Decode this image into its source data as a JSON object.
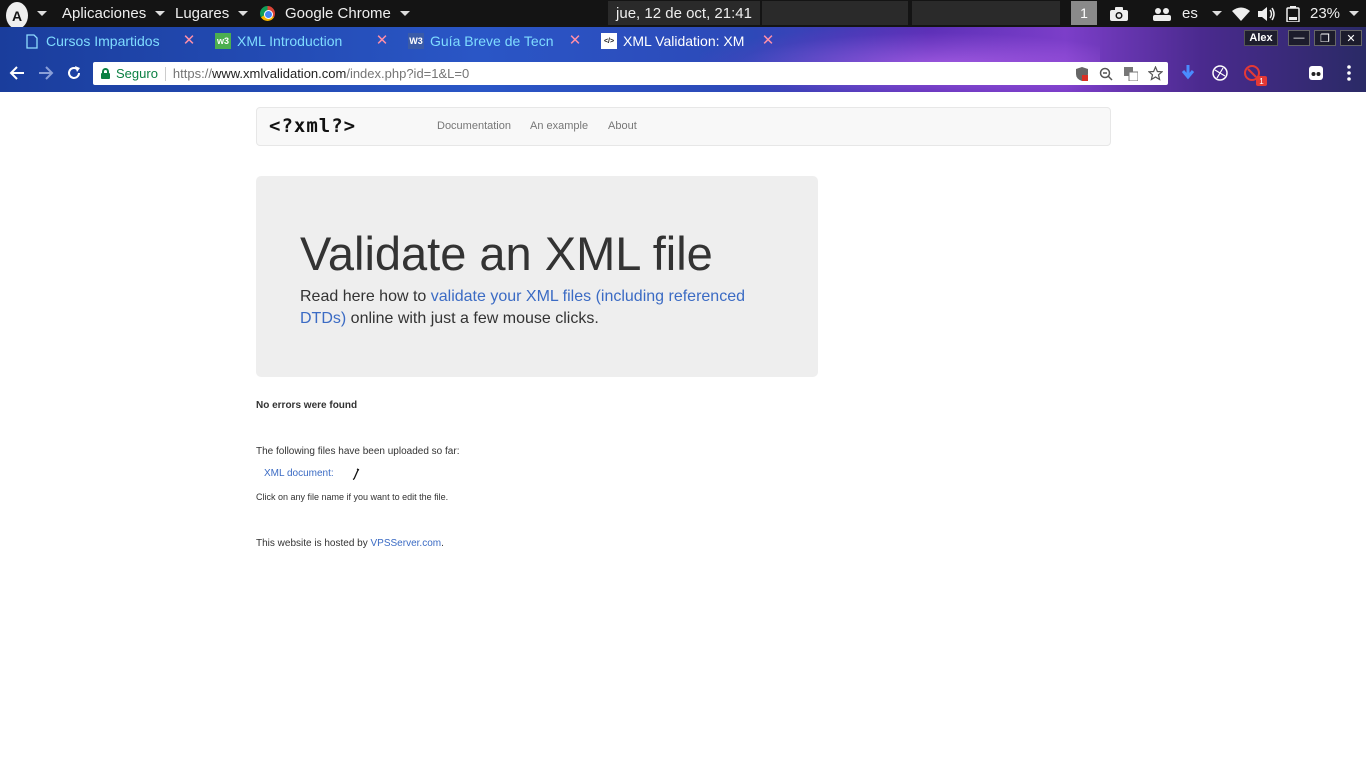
{
  "panel": {
    "apps_menu": "Aplicaciones",
    "places_menu": "Lugares",
    "active_app": "Google Chrome",
    "clock": "jue, 12 de oct, 21:41",
    "workspace": "1",
    "keyboard_layout": "es",
    "battery": "23%"
  },
  "browser": {
    "tabs": [
      {
        "title": "Cursos Impartidos",
        "icon": "document-icon"
      },
      {
        "title": "XML Introduction",
        "icon": "w3schools-icon"
      },
      {
        "title": "Guía Breve de Tecn",
        "icon": "w3c-icon"
      },
      {
        "title": "XML Validation: XM",
        "icon": "xml-site-icon"
      }
    ],
    "profile_name": "Alex",
    "secure_label": "Seguro",
    "url_scheme": "https://",
    "url_host": "www.xmlvalidation.com",
    "url_path": "/index.php?id=1&L=0",
    "extension_badge": "1"
  },
  "site": {
    "logo": "<?xml?>",
    "nav": [
      "Documentation",
      "An example",
      "About"
    ],
    "jumbotron": {
      "title": "Validate an XML file",
      "text_before": "Read here how to ",
      "link_text": "validate your XML files (including referenced DTDs)",
      "text_after": " online with just a few mouse clicks."
    },
    "result": "No errors were found",
    "uploaded_heading": "The following files have been uploaded so far:",
    "xml_document_link": "XML document:",
    "edit_hint": "Click on any file name if you want to edit the file.",
    "hosted_prefix": "This website is hosted by ",
    "hosted_link": "VPSServer.com",
    "hosted_suffix": "."
  }
}
